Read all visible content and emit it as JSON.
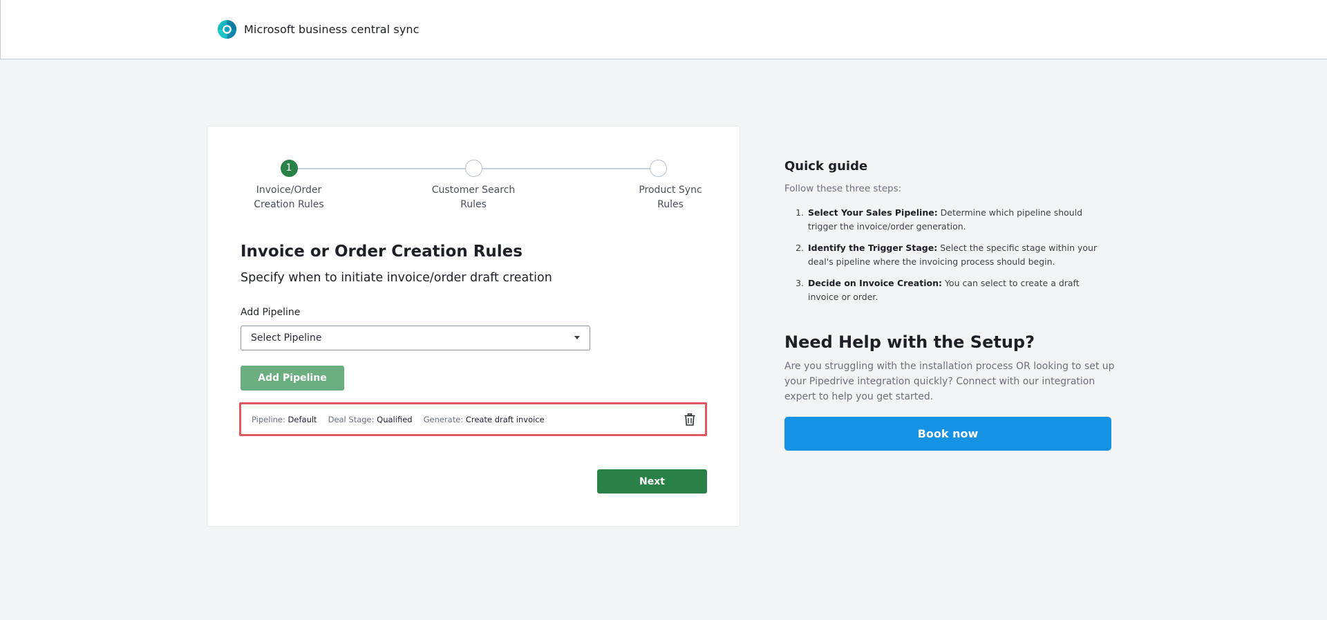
{
  "header": {
    "app_name": "Microsoft business central sync"
  },
  "stepper": {
    "steps": [
      {
        "number": "1",
        "label": "Invoice/Order Creation Rules",
        "state": "active"
      },
      {
        "number": "",
        "label": "Customer Search Rules",
        "state": "pending"
      },
      {
        "number": "",
        "label": "Product Sync Rules",
        "state": "pending"
      }
    ]
  },
  "form": {
    "title": "Invoice or Order Creation Rules",
    "subtitle": "Specify when to initiate invoice/order draft creation",
    "pipeline_label": "Add Pipeline",
    "pipeline_select_value": "Select Pipeline",
    "add_button": "Add Pipeline",
    "next_button": "Next"
  },
  "rules": [
    {
      "pipeline_key": "Pipeline:",
      "pipeline_value": "Default",
      "stage_key": "Deal Stage:",
      "stage_value": "Qualified",
      "generate_key": "Generate:",
      "generate_value": "Create draft invoice"
    }
  ],
  "guide": {
    "title": "Quick guide",
    "intro": "Follow these three steps:",
    "steps": [
      {
        "bold": "Select Your Sales Pipeline:",
        "text": " Determine which pipeline should trigger the invoice/order generation."
      },
      {
        "bold": "Identify the Trigger Stage:",
        "text": " Select the specific stage within your deal's pipeline where the invoicing process should begin."
      },
      {
        "bold": "Decide on Invoice Creation:",
        "text": " You can select to create a draft invoice or order."
      }
    ]
  },
  "help": {
    "title": "Need Help with the Setup?",
    "text": "Are you struggling with the installation process OR looking to set up your Pipedrive integration quickly? Connect with our integration expert to help you get started.",
    "button": "Book now"
  },
  "colors": {
    "primary_green": "#2a8147",
    "disabled_green": "#6bae80",
    "highlight_red": "#e0575f",
    "book_blue": "#1592e4"
  }
}
